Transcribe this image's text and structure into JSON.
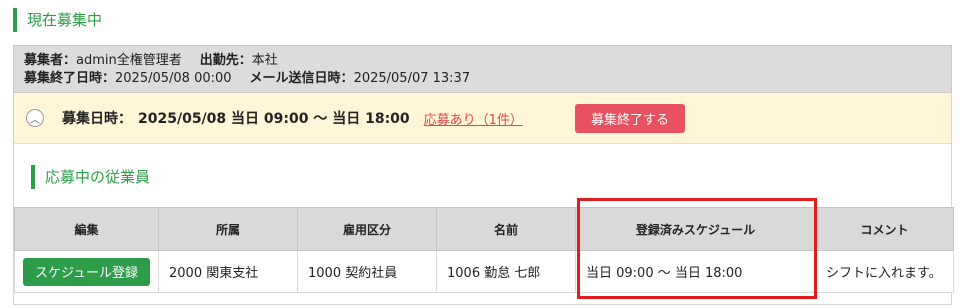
{
  "header": {
    "title": "現在募集中"
  },
  "summary": {
    "recruiter_label": "募集者：",
    "recruiter_value": "admin全権管理者",
    "workplace_label": "出勤先：",
    "workplace_value": "本社",
    "end_label": "募集終了日時：",
    "end_value": "2025/05/08 00:00",
    "mail_label": "メール送信日時：",
    "mail_value": "2025/05/07 13:37"
  },
  "date_bar": {
    "label": "募集日時：",
    "value": "2025/05/08 当日 09:00 〜 当日 18:00",
    "apply_link": "応募あり（1件）",
    "end_button": "募集終了する",
    "toggle_icon": "chevron-up-icon"
  },
  "applicants": {
    "title": "応募中の従業員",
    "columns": [
      "編集",
      "所属",
      "雇用区分",
      "名前",
      "登録済みスケジュール",
      "コメント"
    ],
    "rows": [
      {
        "edit_button": "スケジュール登録",
        "department": "2000 関東支社",
        "employment": "1000 契約社員",
        "name": "1006 勤怠 七郎",
        "schedule": "当日 09:00 〜 当日 18:00",
        "comment": "シフトに入れます。"
      }
    ]
  },
  "colors": {
    "accent": "#2e9d4a",
    "danger": "#e8515f",
    "highlight": "#e21b1b",
    "date_bar_bg": "#fff6d8"
  }
}
